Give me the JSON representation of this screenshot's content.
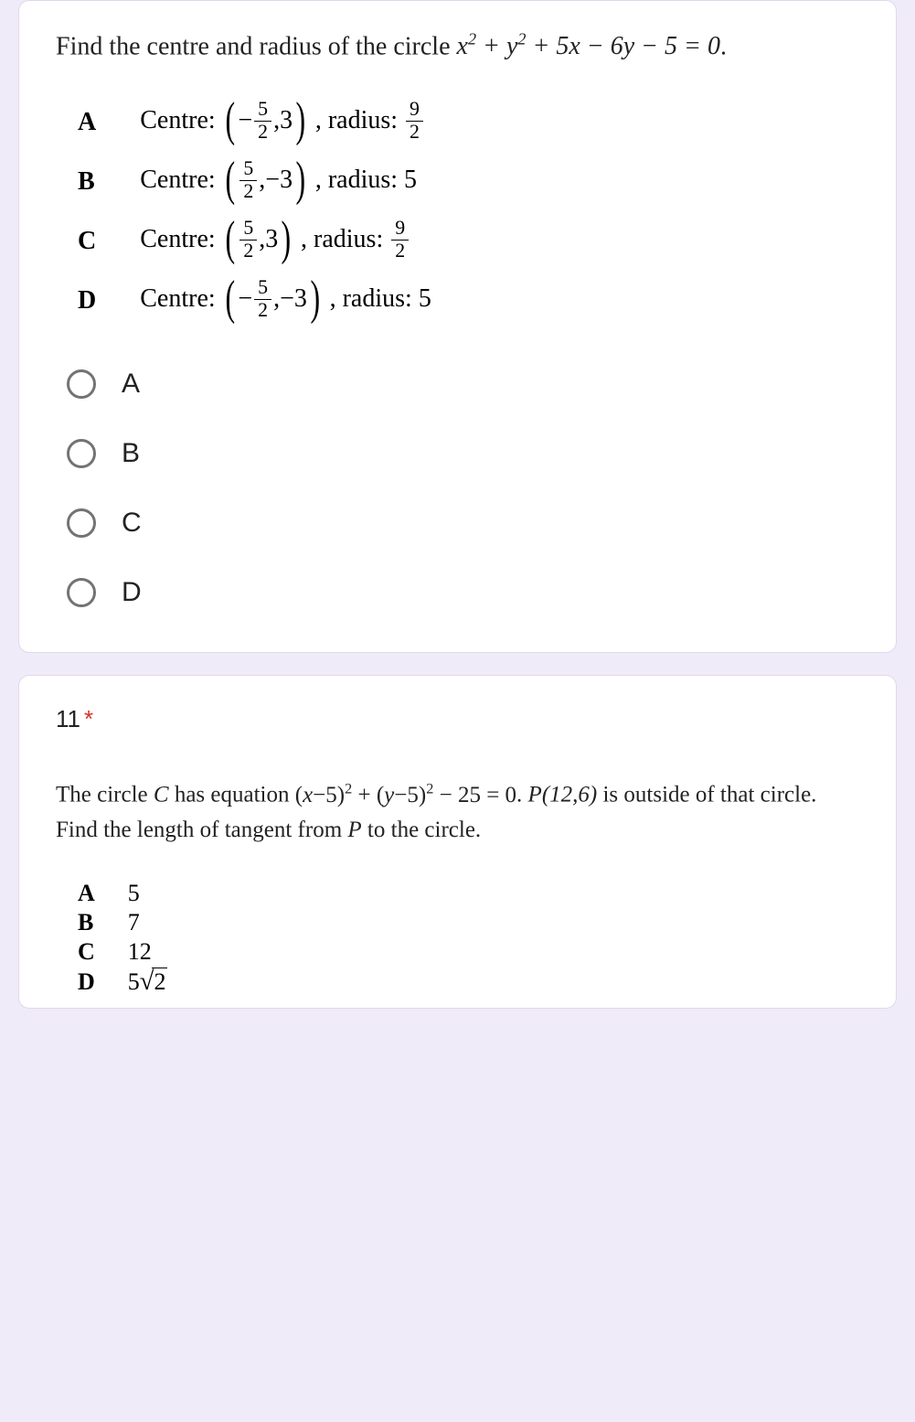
{
  "q10": {
    "prompt_prefix": "Find the centre and radius of the circle ",
    "equation": "x² + y² + 5x − 6y − 5 = 0",
    "prompt_suffix": ".",
    "options": {
      "A": {
        "key": "A",
        "centre_label": "Centre: ",
        "centre_pre_frac": "−",
        "centre_frac_num": "5",
        "centre_frac_den": "2",
        "centre_post": ",3",
        "radius_label": " , radius: ",
        "radius_frac_num": "9",
        "radius_frac_den": "2",
        "radius_plain": ""
      },
      "B": {
        "key": "B",
        "centre_label": "Centre: ",
        "centre_pre_frac": "",
        "centre_frac_num": "5",
        "centre_frac_den": "2",
        "centre_post": ",−3",
        "radius_label": " , radius: ",
        "radius_frac_num": "",
        "radius_frac_den": "",
        "radius_plain": "5"
      },
      "C": {
        "key": "C",
        "centre_label": "Centre: ",
        "centre_pre_frac": "",
        "centre_frac_num": "5",
        "centre_frac_den": "2",
        "centre_post": ",3",
        "radius_label": " , radius: ",
        "radius_frac_num": "9",
        "radius_frac_den": "2",
        "radius_plain": ""
      },
      "D": {
        "key": "D",
        "centre_label": "Centre: ",
        "centre_pre_frac": "−",
        "centre_frac_num": "5",
        "centre_frac_den": "2",
        "centre_post": ",−3",
        "radius_label": " , radius: ",
        "radius_frac_num": "",
        "radius_frac_den": "",
        "radius_plain": "5"
      }
    },
    "radios": {
      "A": "A",
      "B": "B",
      "C": "C",
      "D": "D"
    }
  },
  "q11": {
    "number": "11",
    "required": "*",
    "prompt_1": "The circle ",
    "C": "C",
    "prompt_2": " has equation ",
    "eq_lhs1": "(x−5)",
    "eq_sup": "2",
    "eq_plus": " + ",
    "eq_lhs2": "(y−5)",
    "eq_rest": " − 25 = 0",
    "prompt_3": ". ",
    "P": "P(12,6)",
    "prompt_4": " is outside of that circle. Find the length of tangent from ",
    "P2": "P",
    "prompt_5": " to the circle.",
    "options": {
      "A": {
        "key": "A",
        "val": "5"
      },
      "B": {
        "key": "B",
        "val": "7"
      },
      "C": {
        "key": "C",
        "val": "12"
      },
      "D": {
        "key": "D",
        "val_pre": "5",
        "val_sqrt": "2"
      }
    }
  }
}
